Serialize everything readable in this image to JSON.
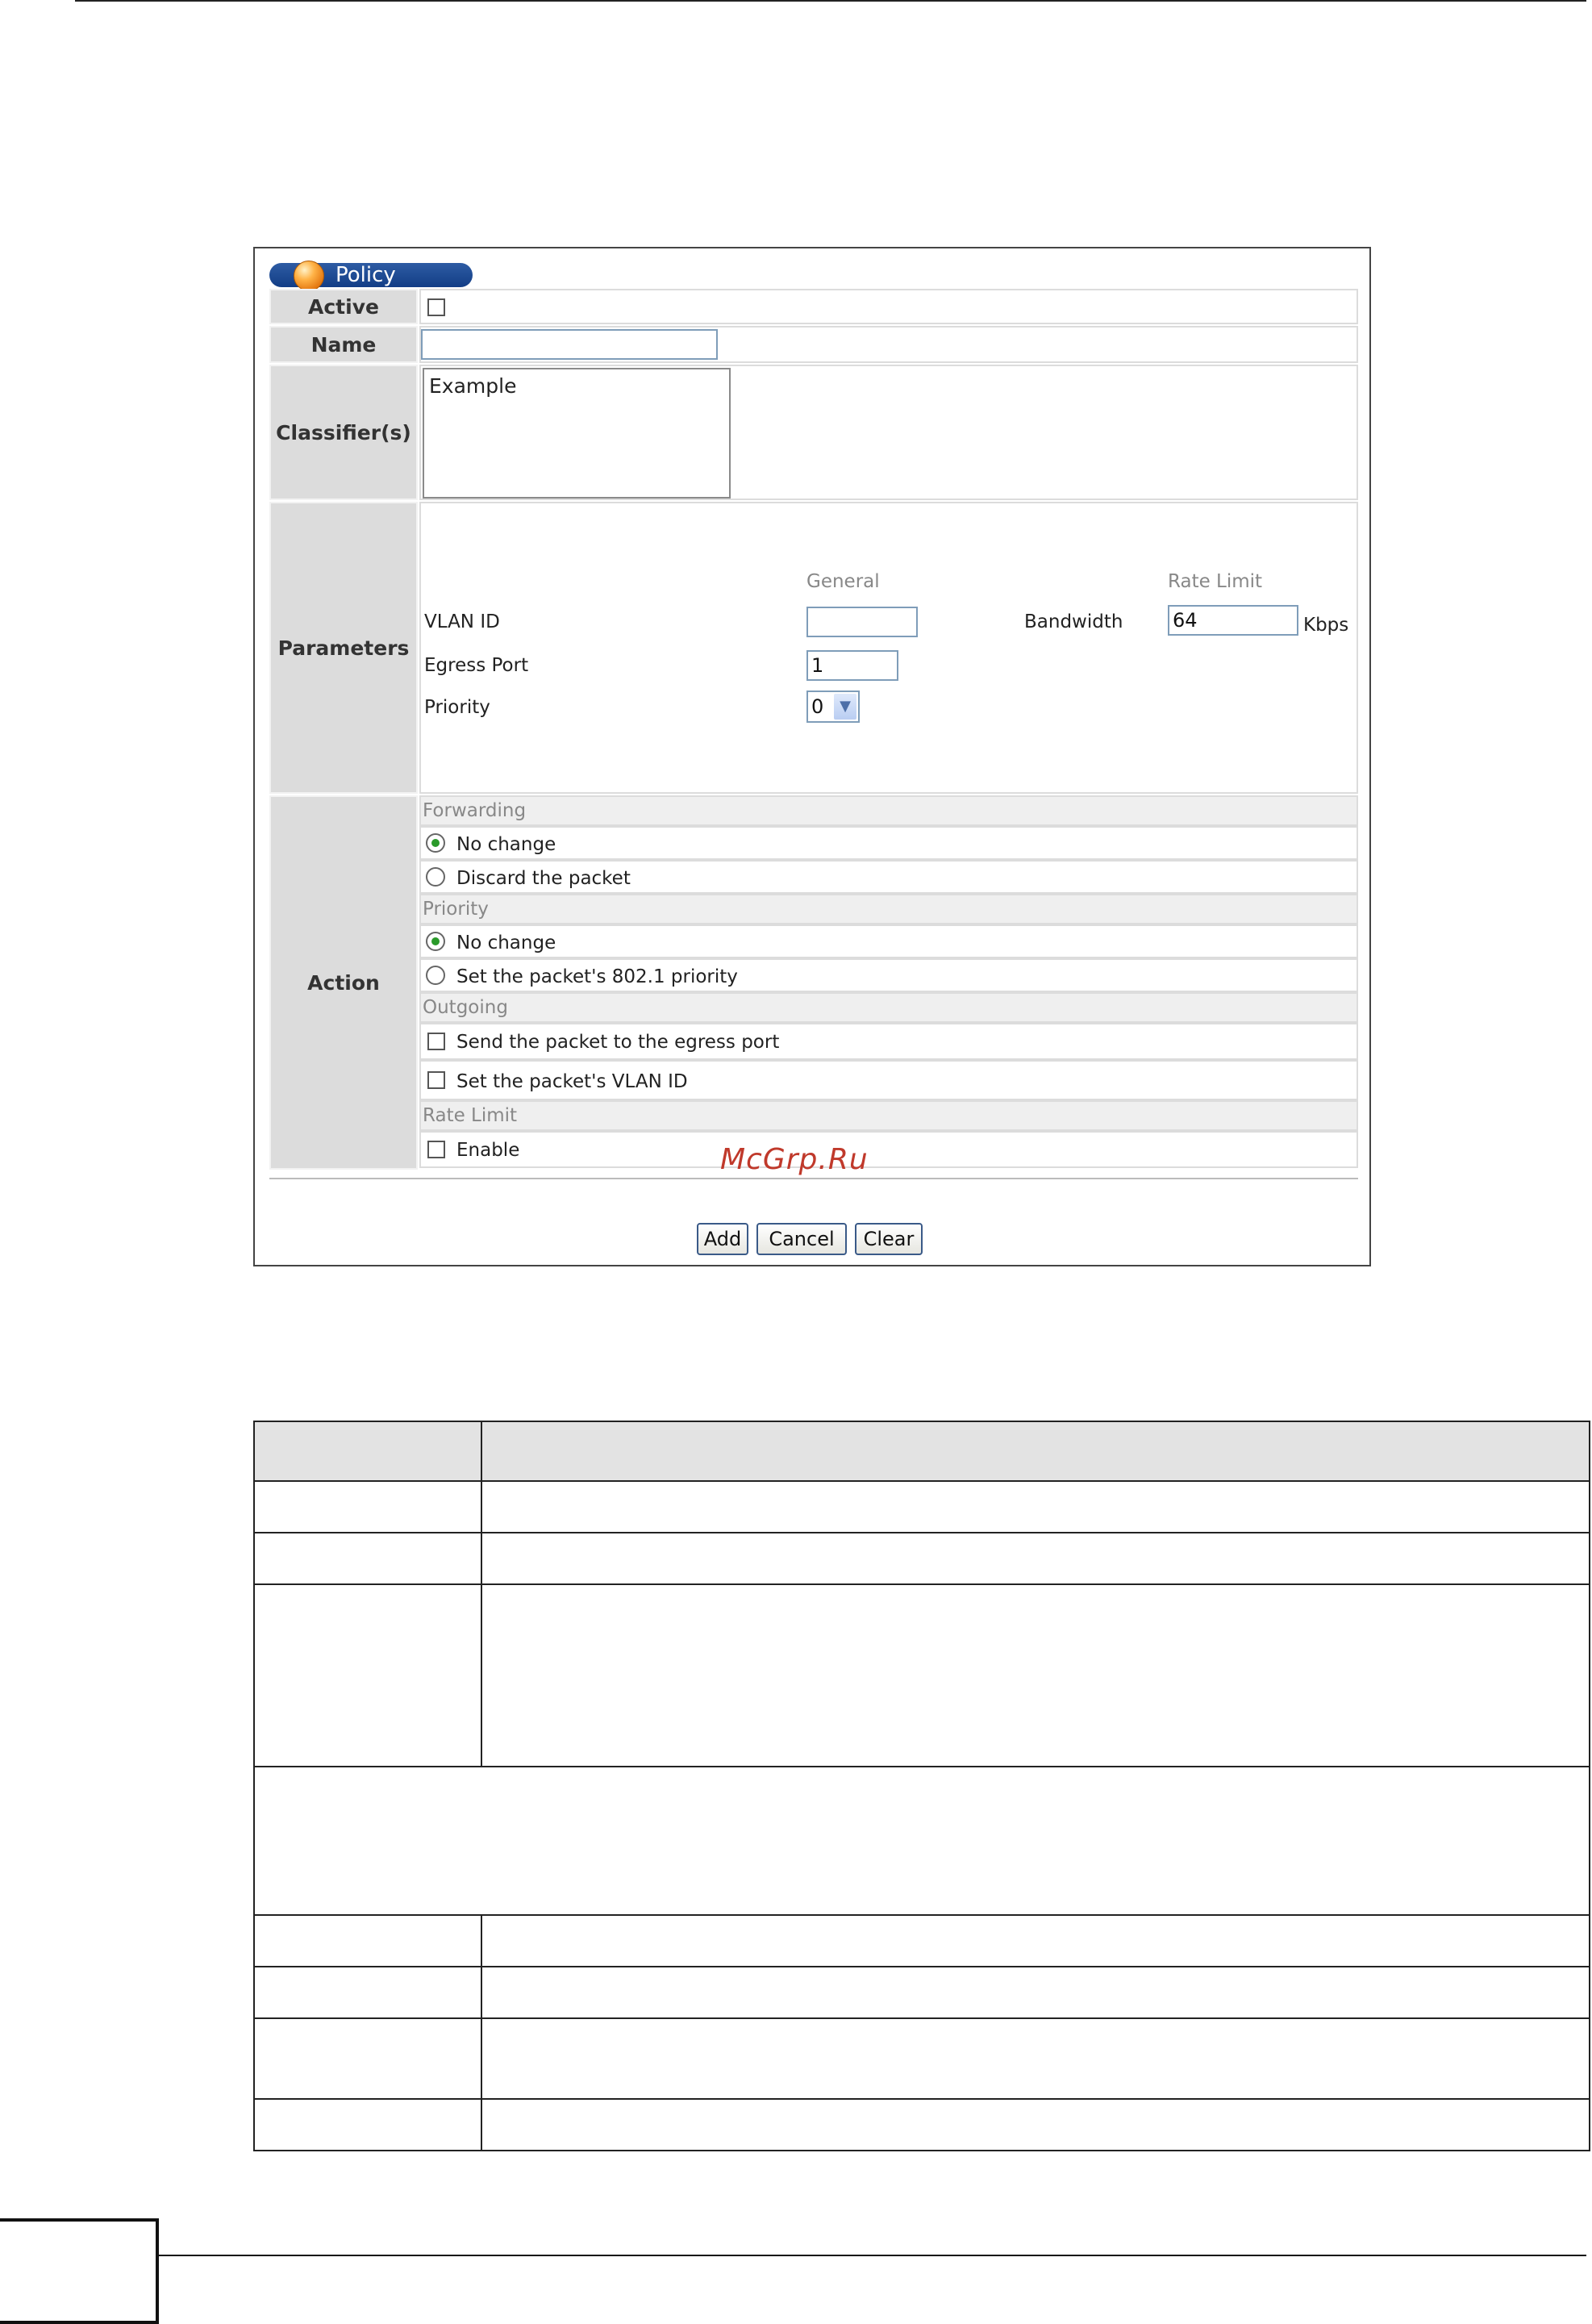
{
  "policy_form": {
    "panel_title": "Policy",
    "active_label": "Active",
    "name_label": "Name",
    "name_value": "",
    "classifiers_label": "Classifier(s)",
    "classifiers_options": [
      "Example"
    ],
    "parameters_label": "Parameters",
    "general_header": "General",
    "rate_limit_header": "Rate Limit",
    "vlan_id_label": "VLAN ID",
    "vlan_id_value": "",
    "egress_port_label": "Egress Port",
    "egress_port_value": "1",
    "priority_label": "Priority",
    "priority_selected": "0",
    "bandwidth_label": "Bandwidth",
    "bandwidth_value": "64",
    "bandwidth_unit": "Kbps",
    "action_label": "Action",
    "forwarding_header": "Forwarding",
    "forwarding_no_change": "No change",
    "forwarding_discard": "Discard the packet",
    "priority_header": "Priority",
    "priority_no_change": "No change",
    "priority_set": "Set the packet's 802.1 priority",
    "outgoing_header": "Outgoing",
    "outgoing_send_egress": "Send the packet to the egress port",
    "outgoing_set_vlan": "Set the packet's VLAN ID",
    "rate_limit_section_header": "Rate Limit",
    "rate_limit_enable": "Enable",
    "add_button": "Add",
    "cancel_button": "Cancel",
    "clear_button": "Clear",
    "state": {
      "active": false,
      "forwarding": "No change",
      "priority": "No change",
      "send_to_egress": false,
      "set_vlan_id": false,
      "rate_limit_enable": false
    }
  },
  "watermark": "McGrp.Ru",
  "colors": {
    "panel_tab": "#1f4a95",
    "label_cell": "#dcdcdc",
    "radio_selected": "#2a9a2a",
    "watermark": "#c0392b"
  }
}
